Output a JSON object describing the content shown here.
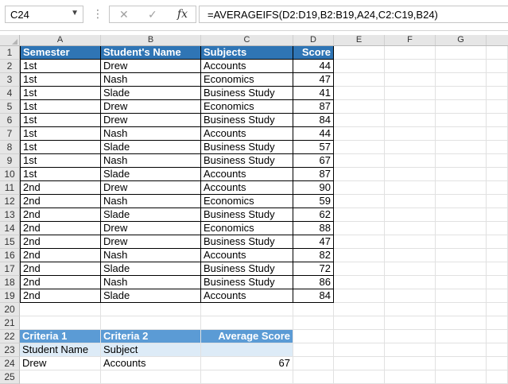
{
  "formula_bar": {
    "name_box": "C24",
    "cancel_symbol": "✕",
    "enter_symbol": "✓",
    "fx_label": "fx",
    "formula": "=AVERAGEIFS(D2:D19,B2:B19,A24,C2:C19,B24)"
  },
  "columns": [
    "A",
    "B",
    "C",
    "D",
    "E",
    "F",
    "G"
  ],
  "rows": [
    "1",
    "2",
    "3",
    "4",
    "5",
    "6",
    "7",
    "8",
    "9",
    "10",
    "11",
    "12",
    "13",
    "14",
    "15",
    "16",
    "17",
    "18",
    "19",
    "20",
    "21",
    "22",
    "23",
    "24",
    "25"
  ],
  "table": {
    "headers": [
      "Semester",
      "Student's Name",
      "Subjects",
      "Score"
    ],
    "data": [
      [
        "1st",
        "Drew",
        "Accounts",
        "44"
      ],
      [
        "1st",
        "Nash",
        "Economics",
        "47"
      ],
      [
        "1st",
        "Slade",
        "Business Study",
        "41"
      ],
      [
        "1st",
        "Drew",
        "Economics",
        "87"
      ],
      [
        "1st",
        "Drew",
        "Business Study",
        "84"
      ],
      [
        "1st",
        "Nash",
        "Accounts",
        "44"
      ],
      [
        "1st",
        "Slade",
        "Business Study",
        "57"
      ],
      [
        "1st",
        "Nash",
        "Business Study",
        "67"
      ],
      [
        "1st",
        "Slade",
        "Accounts",
        "87"
      ],
      [
        "2nd",
        "Drew",
        "Accounts",
        "90"
      ],
      [
        "2nd",
        "Nash",
        "Economics",
        "59"
      ],
      [
        "2nd",
        "Slade",
        "Business Study",
        "62"
      ],
      [
        "2nd",
        "Drew",
        "Economics",
        "88"
      ],
      [
        "2nd",
        "Drew",
        "Business Study",
        "47"
      ],
      [
        "2nd",
        "Nash",
        "Accounts",
        "82"
      ],
      [
        "2nd",
        "Slade",
        "Business Study",
        "72"
      ],
      [
        "2nd",
        "Nash",
        "Business Study",
        "86"
      ],
      [
        "2nd",
        "Slade",
        "Accounts",
        "84"
      ]
    ]
  },
  "criteria": {
    "headers": [
      "Criteria 1",
      "Criteria 2",
      "Average Score"
    ],
    "labels": [
      "Student Name",
      "Subject"
    ],
    "values": [
      "Drew",
      "Accounts",
      "67"
    ]
  }
}
